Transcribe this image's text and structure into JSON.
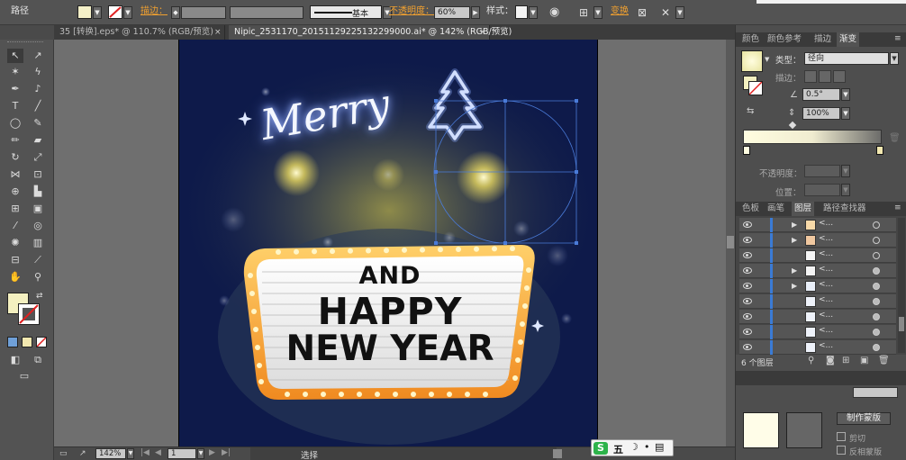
{
  "control_bar": {
    "label_path": "路径",
    "stroke_label": "描边：",
    "stroke_profile": "基本",
    "opacity_label": "不透明度：",
    "opacity_value": "60%",
    "style_label": "样式：",
    "transform_link": "变换"
  },
  "doc_tabs": [
    {
      "label": "35 [转换].eps* @ 110.7% (RGB/预览)",
      "close": "×"
    },
    {
      "label": "Nipic_2531170_20151129225132299000.ai* @ 142% (RGB/预览)",
      "close": "×"
    }
  ],
  "artwork": {
    "merry": "Merry",
    "line1": "AND",
    "line2": "HAPPY",
    "line3": "NEW YEAR"
  },
  "status_bar": {
    "zoom": "142%",
    "page": "1",
    "mode": "选择"
  },
  "gradient_panel": {
    "tabs": [
      "颜色",
      "颜色参考",
      "描边",
      "渐变"
    ],
    "type_label": "类型：",
    "type_value": "径向",
    "stroke_label": "描边：",
    "angle_value": "0.5°",
    "aspect_value": "100%",
    "opacity_label": "不透明度：",
    "position_label": "位置："
  },
  "layers_panel": {
    "tabs": [
      "色板",
      "画笔",
      "图层",
      "路径查找器"
    ],
    "footer_count": "6 个图层",
    "row_label": "<...",
    "make_mask": "制作蒙版",
    "invert_mask": "反相蒙版",
    "clip_label": "剪切"
  },
  "taskbar": {
    "ime": "五",
    "ime_logo": "S"
  },
  "colors": {
    "accent": "#3a7bd5",
    "artboard_bg": "#0e1a4a",
    "link": "#f0a030"
  }
}
